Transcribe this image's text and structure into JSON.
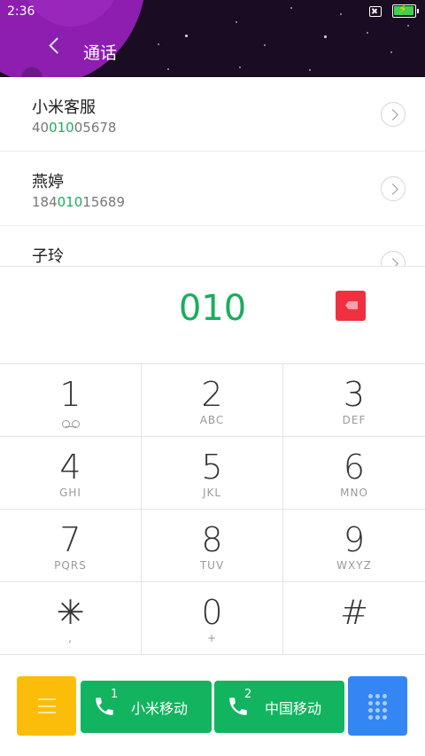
{
  "status_bar": {
    "time": "2:36"
  },
  "header": {
    "title": "通话"
  },
  "contacts": [
    {
      "name": "小米客服",
      "number_pre": "40",
      "number_match": "010",
      "number_post": "05678"
    },
    {
      "name": "燕婷",
      "number_pre": "184",
      "number_match": "010",
      "number_post": "15689"
    },
    {
      "name": "子玲",
      "number_pre": "",
      "number_match": "",
      "number_post": ""
    }
  ],
  "dialer": {
    "input": "010"
  },
  "keys": [
    {
      "digit": "1",
      "letters": ""
    },
    {
      "digit": "2",
      "letters": "ABC"
    },
    {
      "digit": "3",
      "letters": "DEF"
    },
    {
      "digit": "4",
      "letters": "GHI"
    },
    {
      "digit": "5",
      "letters": "JKL"
    },
    {
      "digit": "6",
      "letters": "MNO"
    },
    {
      "digit": "7",
      "letters": "PQRS"
    },
    {
      "digit": "8",
      "letters": "TUV"
    },
    {
      "digit": "9",
      "letters": "WXYZ"
    },
    {
      "digit": "✳",
      "letters": ","
    },
    {
      "digit": "0",
      "letters": "+"
    },
    {
      "digit": "#",
      "letters": ""
    }
  ],
  "bottom_bar": {
    "sim1": {
      "number": "1",
      "label": "小米移动"
    },
    "sim2": {
      "number": "2",
      "label": "中国移动"
    }
  },
  "icons": {
    "back": "chevron-left-icon",
    "backspace": "backspace-icon",
    "voicemail": "voicemail-icon",
    "menu": "menu-icon",
    "phone": "phone-icon",
    "keypad": "dialpad-icon"
  },
  "colors": {
    "accent_green": "#1aad5e",
    "call_green": "#13b45f",
    "backspace_red": "#f0303f",
    "menu_yellow": "#fbbd09",
    "keypad_blue": "#3486f4",
    "header_purple": "#8d1eb0"
  }
}
